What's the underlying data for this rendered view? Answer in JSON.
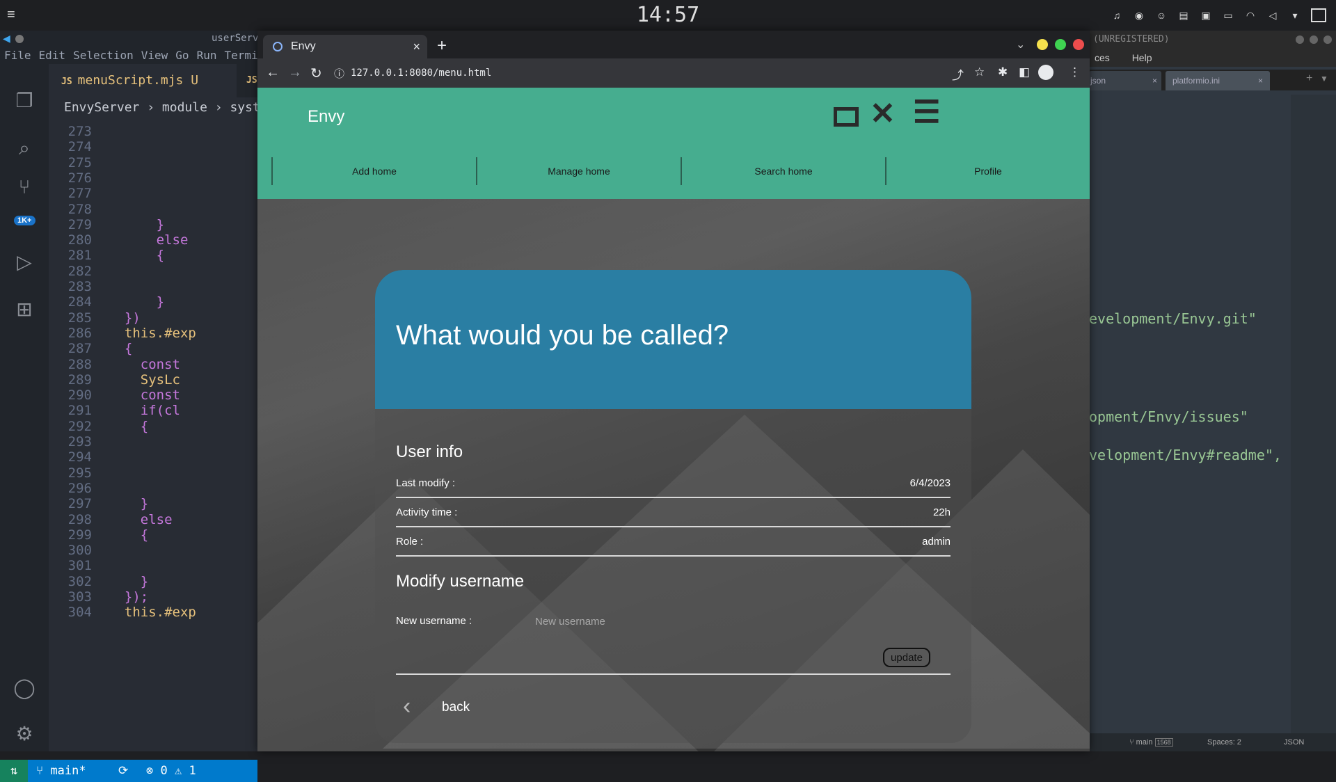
{
  "desktop": {
    "clock": "14:57"
  },
  "vscode": {
    "window_title": "userServ",
    "menu": [
      "File",
      "Edit",
      "Selection",
      "View",
      "Go",
      "Run",
      "Termin"
    ],
    "tab_label": "menuScript.mjs",
    "tab_status": "U",
    "second_tab_prefix": "JS",
    "breadcrumb": [
      "EnvyServer",
      "module",
      "syste"
    ],
    "badge": "1K+",
    "line_numbers": [
      "273",
      "274",
      "275",
      "276",
      "277",
      "278",
      "279",
      "280",
      "281",
      "282",
      "283",
      "284",
      "285",
      "286",
      "287",
      "288",
      "289",
      "290",
      "291",
      "292",
      "293",
      "294",
      "295",
      "296",
      "297",
      "298",
      "299",
      "300",
      "301",
      "302",
      "303",
      "304"
    ],
    "code_lines": [
      "",
      "",
      "",
      "",
      "",
      "",
      "      }",
      "      else",
      "      {",
      "",
      "",
      "      }",
      "  })",
      "  this.#exp",
      "  {",
      "    const",
      "    SysLc",
      "    const",
      "    if(cl",
      "    {",
      "",
      "",
      "",
      "",
      "    }",
      "    else",
      "    {",
      "",
      "",
      "    }",
      "  });",
      "  this.#exp"
    ],
    "status": {
      "branch": "main*",
      "errors": "0",
      "warnings": "1"
    }
  },
  "sublime": {
    "title": "(UNREGISTERED)",
    "menu": [
      "ces",
      "Help"
    ],
    "tabs": [
      "json",
      "platformio.ini"
    ],
    "code_lines": [
      "evelopment/Envy.git\"",
      "opment/Envy/issues\"",
      "velopment/Envy#readme\","
    ],
    "status": {
      "branch": "main",
      "count": "1568",
      "spaces": "Spaces: 2",
      "syntax": "JSON"
    }
  },
  "browser": {
    "tab_title": "Envy",
    "url": "127.0.0.1:8080/menu.html"
  },
  "app": {
    "brand": "Envy",
    "nav": [
      "Add home",
      "Manage home",
      "Search home",
      "Profile"
    ],
    "card_title": "What would you be called?",
    "user_info_title": "User info",
    "rows": [
      {
        "label": "Last modify :",
        "value": "6/4/2023"
      },
      {
        "label": "Activity time :",
        "value": "22h"
      },
      {
        "label": "Role :",
        "value": "admin"
      }
    ],
    "modify_title": "Modify username",
    "new_username_label": "New username :",
    "new_username_placeholder": "New username",
    "update_label": "update",
    "back_label": "back"
  }
}
